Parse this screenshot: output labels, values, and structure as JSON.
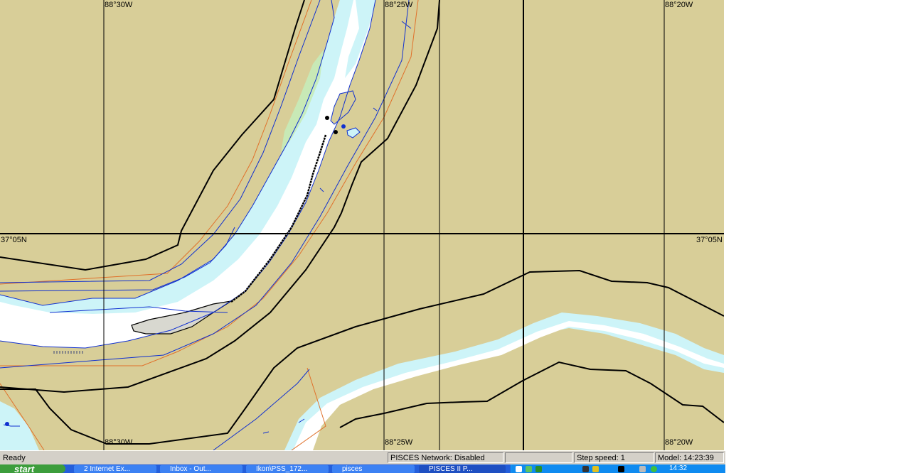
{
  "map": {
    "colors": {
      "land": "#d8ce98",
      "water": "#ffffff",
      "shallow": "#cdf4f8",
      "green_shoal": "#c6ecb9",
      "channel_limit": "#e0702a",
      "depth_contour": "#1030d0",
      "levee": "#000000",
      "gridline": "#000000"
    },
    "grid_labels": {
      "lon_west_top": "88°30W",
      "lon_mid_top": "88°25W",
      "lon_east_top": "88°20W",
      "lon_west_bottom": "88°30W",
      "lon_mid_bottom": "88°25W",
      "lon_east_bottom": "88°20W",
      "lat_left": "37°05N",
      "lat_right": "37°05N"
    }
  },
  "statusbar": {
    "ready": "Ready",
    "network": "PISCES Network: Disabled",
    "blank": "",
    "step_speed": "Step speed: 1",
    "model_time": "Model: 14:23:39"
  },
  "taskbar": {
    "start": "start",
    "tasks": [
      {
        "label": "2 Internet Ex..."
      },
      {
        "label": "Inbox - Out..."
      },
      {
        "label": "Ikon\\PSS_172..."
      },
      {
        "label": "pisces"
      },
      {
        "label": "PISCES II P..."
      }
    ],
    "clock": "14:32"
  }
}
